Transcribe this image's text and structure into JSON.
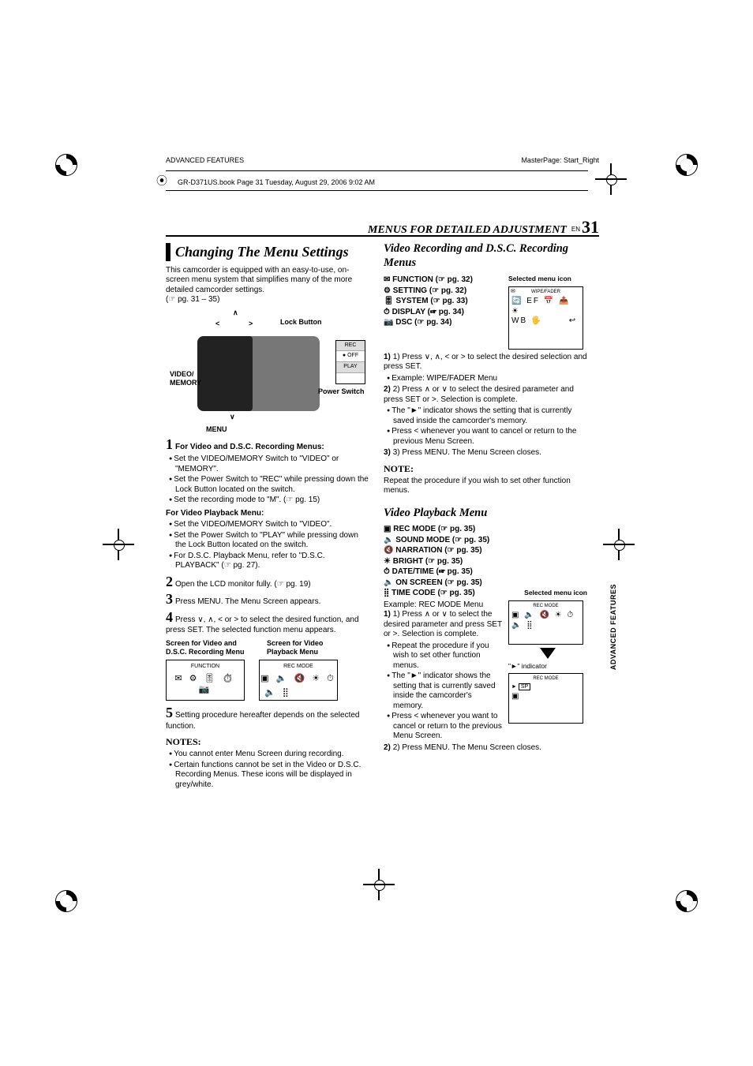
{
  "meta": {
    "left_header": "ADVANCED FEATURES",
    "right_header": "MasterPage: Start_Right",
    "book_line": "GR-D371US.book  Page 31  Tuesday, August 29, 2006  9:02 AM"
  },
  "title_row": {
    "section": "MENUS FOR DETAILED ADJUSTMENT",
    "en": "EN",
    "page": "31"
  },
  "side_label": "ADVANCED FEATURES",
  "left": {
    "h_main": "Changing The Menu Settings",
    "intro": "This camcorder is equipped with an easy-to-use, on-screen menu system that simplifies many of the more detailed camcorder settings.",
    "intro_ref": "(☞ pg. 31 – 35)",
    "cam_labels": {
      "lock": "Lock Button",
      "power": "Power Switch",
      "video": "VIDEO/\nMEMORY",
      "menu": "MENU",
      "sw1": "REC",
      "sw2": "OFF",
      "sw3": "PLAY"
    },
    "step1_h": "For Video and D.S.C. Recording Menus:",
    "step1_b": [
      "Set the VIDEO/MEMORY Switch to \"VIDEO\" or \"MEMORY\".",
      "Set the Power Switch to \"REC\" while pressing down the Lock Button located on the switch.",
      "Set the recording mode to \"M\". (☞ pg. 15)"
    ],
    "vpm_h": "For Video Playback Menu:",
    "vpm_b": [
      "Set the VIDEO/MEMORY Switch to \"VIDEO\".",
      "Set the Power Switch to \"PLAY\" while pressing down the Lock Button located on the switch.",
      "For D.S.C. Playback Menu, refer to \"D.S.C. PLAYBACK\" (☞ pg. 27)."
    ],
    "step2": "Open the LCD monitor fully. (☞ pg. 19)",
    "step3": "Press MENU. The Menu Screen appears.",
    "step4": "Press ∨, ∧, < or > to select the desired function, and press SET. The selected function menu appears.",
    "screens_l": "Screen for Video and D.S.C. Recording Menu",
    "screens_r": "Screen for Video Playback Menu",
    "box_l": "FUNCTION",
    "box_r": "REC MODE",
    "step5": "Setting procedure hereafter depends on the selected function.",
    "notes_h": "NOTES:",
    "notes": [
      "You cannot enter Menu Screen during recording.",
      "Certain functions cannot be set in the Video or D.S.C. Recording Menus. These icons will be displayed in grey/white."
    ]
  },
  "right": {
    "h_sub": "Video Recording and D.S.C. Recording Menus",
    "menus": [
      "FUNCTION (☞ pg. 32)",
      "SETTING (☞ pg. 32)",
      "SYSTEM (☞ pg. 33)",
      "DISPLAY (☞ pg. 34)",
      "DSC (☞ pg. 34)"
    ],
    "sel_lbl": "Selected menu icon",
    "box1": "WIPE/FADER",
    "s1": "1) Press ∨, ∧, < or > to select the desired selection and press SET.",
    "s1b": "Example: WIPE/FADER Menu",
    "s2": "2) Press ∧ or ∨ to select the desired parameter and press SET or >. Selection is complete.",
    "s2_b": [
      "The \"►\" indicator shows the setting that is currently saved inside the camcorder's memory.",
      "Press < whenever you want to cancel or return to the previous Menu Screen."
    ],
    "s3": "3) Press MENU. The Menu Screen closes.",
    "note_h": "NOTE:",
    "note": "Repeat the procedure if you wish to set other function menus.",
    "h_sub2": "Video Playback Menu",
    "menus2": [
      "REC MODE (☞ pg. 35)",
      "SOUND MODE (☞ pg. 35)",
      "NARRATION (☞ pg. 35)",
      "BRIGHT (☞ pg. 35)",
      "DATE/TIME (☞ pg. 35)",
      "ON SCREEN (☞ pg. 35)",
      "TIME CODE (☞ pg. 35)"
    ],
    "ex2": "Example: REC MODE Menu",
    "p1": "1) Press ∧ or ∨ to select the desired parameter and press SET or >. Selection is complete.",
    "p1_b": [
      "Repeat the procedure if you wish to set other function menus.",
      "The \"►\" indicator shows the setting that is currently saved inside the camcorder's memory.",
      "Press < whenever you want to cancel or return to the previous Menu Screen."
    ],
    "p2": "2) Press MENU. The Menu Screen closes.",
    "ind_lbl": "\"►\" indicator",
    "box2": "REC MODE",
    "box3": "REC MODE",
    "box3_opt": "SP"
  }
}
